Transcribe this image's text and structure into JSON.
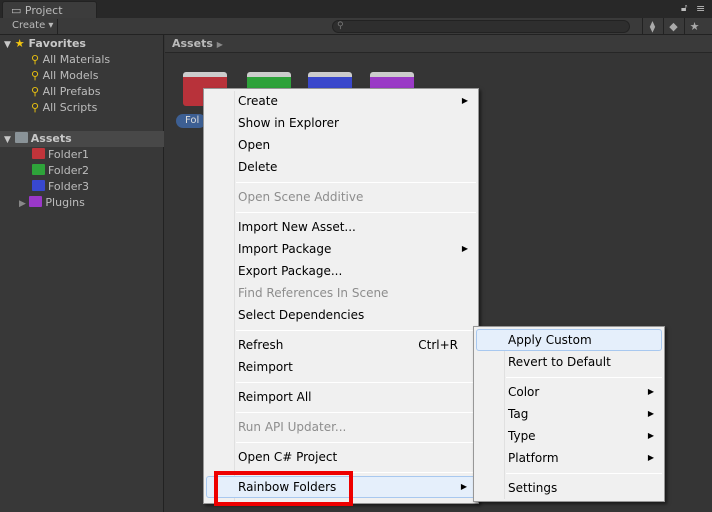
{
  "window": {
    "tab_title": "Project"
  },
  "toolbar": {
    "create_label": "Create ▾",
    "search_placeholder": "",
    "icons": [
      "lock-icon",
      "menu-icon",
      "filter-by-type-icon",
      "filter-by-label-icon",
      "favorite-star-icon"
    ]
  },
  "sidebar": {
    "favorites_label": "Favorites",
    "favorites": [
      "All Materials",
      "All Models",
      "All Prefabs",
      "All Scripts"
    ],
    "assets_label": "Assets",
    "folders": [
      {
        "label": "Folder1",
        "color": "#c0343a"
      },
      {
        "label": "Folder2",
        "color": "#2ea43a"
      },
      {
        "label": "Folder3",
        "color": "#3848d0"
      },
      {
        "label": "Plugins",
        "color": "#9a38c8"
      }
    ]
  },
  "main": {
    "breadcrumb": "Assets",
    "grid_folder_colors": [
      "#b8323a",
      "#2ea23a",
      "#3a48cc",
      "#9a3ac6"
    ],
    "selected_label": "Fol"
  },
  "context_menu": {
    "items": [
      {
        "label": "Create",
        "submenu": true
      },
      {
        "label": "Show in Explorer"
      },
      {
        "label": "Open"
      },
      {
        "label": "Delete"
      },
      {
        "label": "Open Scene Additive",
        "disabled": true
      },
      {
        "label": "Import New Asset..."
      },
      {
        "label": "Import Package",
        "submenu": true
      },
      {
        "label": "Export Package..."
      },
      {
        "label": "Find References In Scene",
        "disabled": true
      },
      {
        "label": "Select Dependencies"
      },
      {
        "label": "Refresh",
        "shortcut": "Ctrl+R"
      },
      {
        "label": "Reimport"
      },
      {
        "label": "Reimport All"
      },
      {
        "label": "Run API Updater...",
        "disabled": true
      },
      {
        "label": "Open C# Project"
      },
      {
        "label": "Rainbow Folders",
        "submenu": true,
        "highlighted": true
      }
    ]
  },
  "submenu": {
    "items": [
      {
        "label": "Apply Custom",
        "highlighted": true
      },
      {
        "label": "Revert to Default"
      },
      {
        "label": "Color",
        "submenu": true
      },
      {
        "label": "Tag",
        "submenu": true
      },
      {
        "label": "Type",
        "submenu": true
      },
      {
        "label": "Platform",
        "submenu": true
      },
      {
        "label": "Settings"
      }
    ]
  },
  "annotation": {
    "highlight_color": "#ee0000"
  }
}
